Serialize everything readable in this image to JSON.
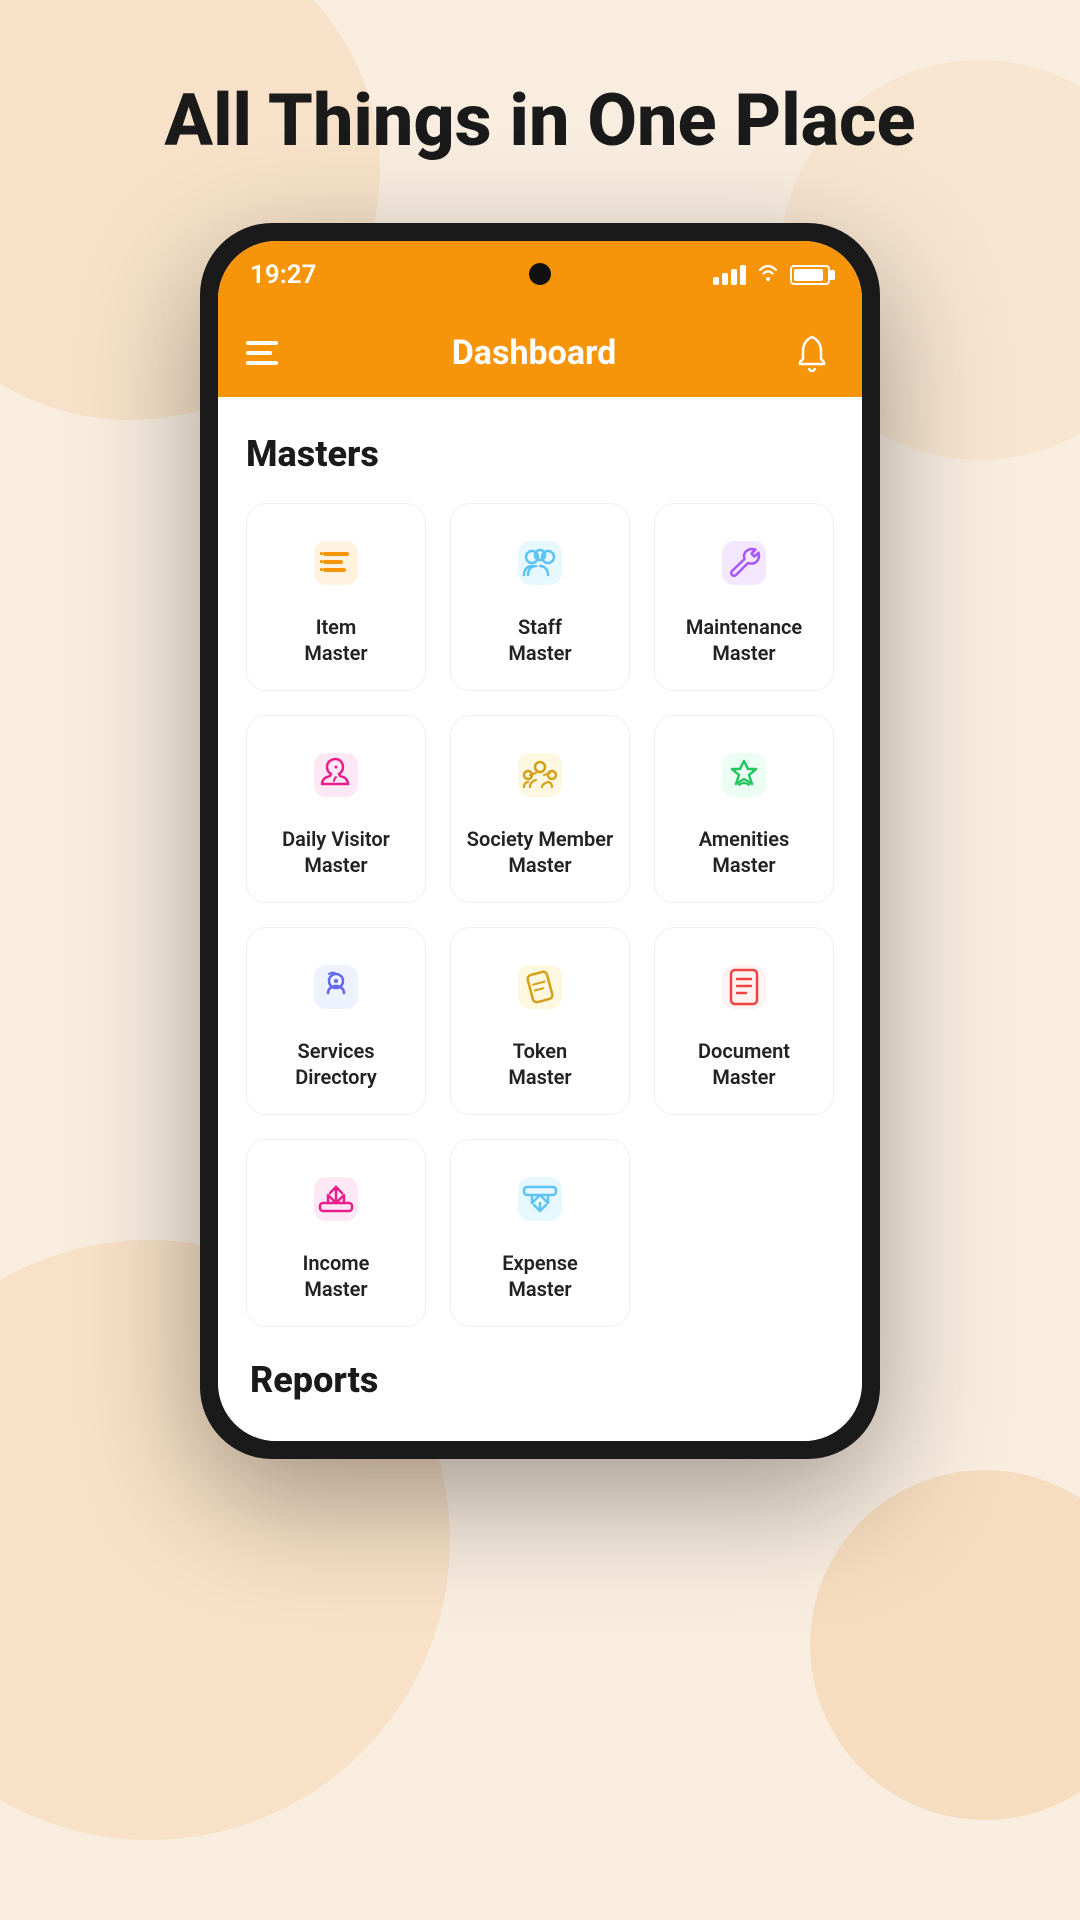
{
  "page": {
    "title": "All Things in One Place"
  },
  "status_bar": {
    "time": "19:27"
  },
  "header": {
    "title": "Dashboard"
  },
  "masters_section": {
    "title": "Masters",
    "items": [
      {
        "id": "item-master",
        "label": "Item\nMaster",
        "color": "#F6940A"
      },
      {
        "id": "staff-master",
        "label": "Staff\nMaster",
        "color": "#5BC4F5"
      },
      {
        "id": "maintenance-master",
        "label": "Maintenance\nMaster",
        "color": "#A855F7"
      },
      {
        "id": "daily-visitor-master",
        "label": "Daily Visitor\nMaster",
        "color": "#E91E8C"
      },
      {
        "id": "society-member-master",
        "label": "Society Member\nMaster",
        "color": "#D4A017"
      },
      {
        "id": "amenities-master",
        "label": "Amenities\nMaster",
        "color": "#22C55E"
      },
      {
        "id": "services-directory",
        "label": "Services\nDirectory",
        "color": "#6366F1"
      },
      {
        "id": "token-master",
        "label": "Token\nMaster",
        "color": "#D4A017"
      },
      {
        "id": "document-master",
        "label": "Document\nMaster",
        "color": "#EF4444"
      },
      {
        "id": "income-master",
        "label": "Income\nMaster",
        "color": "#E91E8C"
      },
      {
        "id": "expense-master",
        "label": "Expense\nMaster",
        "color": "#5BC4F5"
      }
    ]
  },
  "reports_section": {
    "title": "Reports"
  }
}
